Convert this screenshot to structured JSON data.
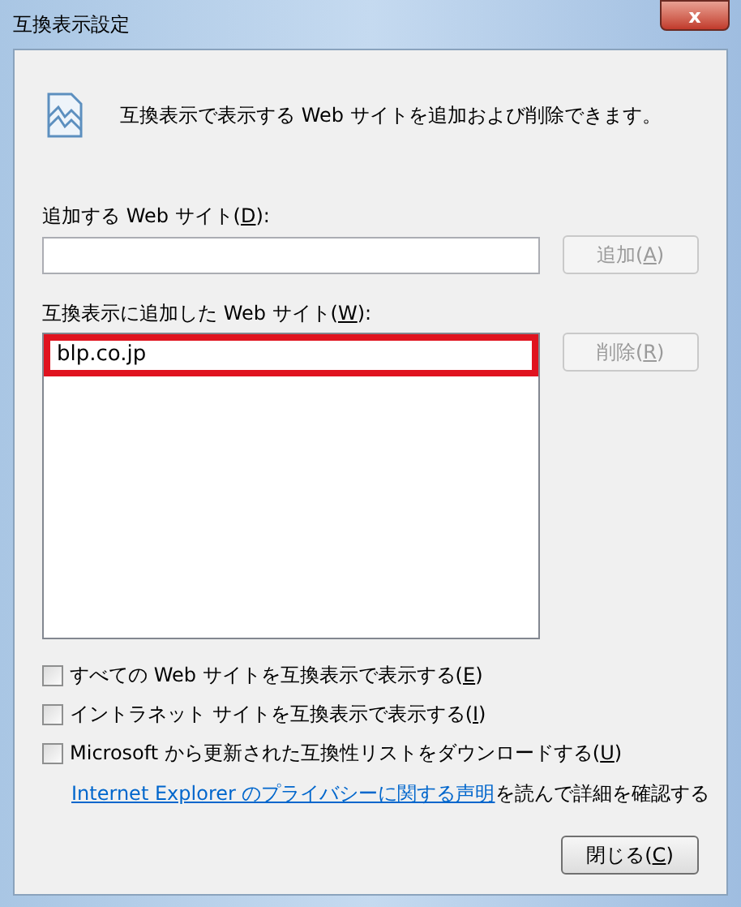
{
  "window": {
    "title": "互換表示設定",
    "close_label": "x"
  },
  "intro": "互換表示で表示する Web サイトを追加および削除できます。",
  "add_field": {
    "label": [
      "追加する Web サイト(",
      "D",
      "):"
    ]
  },
  "add_button": {
    "label": [
      "追加(",
      "A",
      ")"
    ],
    "disabled": true
  },
  "list": {
    "label": [
      "互換表示に追加した Web サイト(",
      "W",
      "):"
    ],
    "items": [
      {
        "text": "blp.co.jp",
        "highlighted": true
      }
    ]
  },
  "remove_button": {
    "label": [
      "削除(",
      "R",
      ")"
    ],
    "disabled": true
  },
  "options": [
    {
      "label": [
        "すべての Web サイトを互換表示で表示する(",
        "E",
        ")"
      ],
      "checked": false
    },
    {
      "label": [
        "イントラネット サイトを互換表示で表示する(",
        "I",
        ")"
      ],
      "checked": false
    },
    {
      "label": [
        "Microsoft から更新された互換性リストをダウンロードする(",
        "U",
        ")"
      ],
      "checked": false
    }
  ],
  "privacy": {
    "link": "Internet Explorer のプライバシーに関する声明",
    "rest": "を読んで詳細を確認する"
  },
  "close_button": {
    "label": [
      "閉じる(",
      "C",
      ")"
    ],
    "disabled": false
  }
}
